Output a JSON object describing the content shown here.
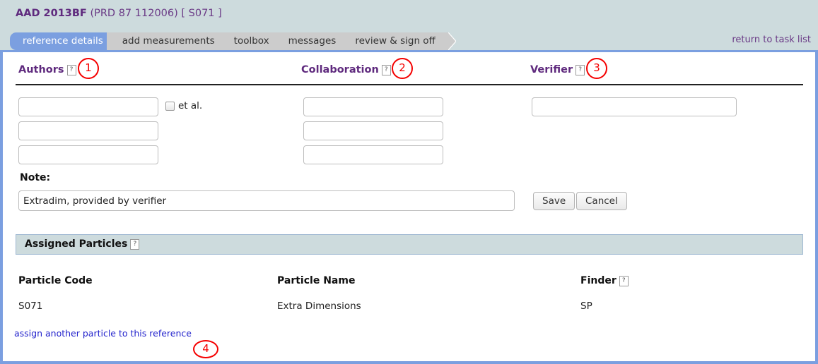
{
  "header": {
    "title_main": "AAD 2013BF",
    "title_sub": "(PRD 87 112006)  [ S071 ]",
    "return_link": "return to task list"
  },
  "tabs": [
    {
      "label": "reference details",
      "active": true
    },
    {
      "label": "add measurements",
      "active": false
    },
    {
      "label": "toolbox",
      "active": false
    },
    {
      "label": "messages",
      "active": false
    },
    {
      "label": "review & sign off",
      "active": false
    }
  ],
  "columns": {
    "authors": {
      "label": "Authors",
      "help": "?"
    },
    "collaboration": {
      "label": "Collaboration",
      "help": "?"
    },
    "verifier": {
      "label": "Verifier",
      "help": "?"
    }
  },
  "fields": {
    "author_1": {
      "value": "",
      "placeholder": ""
    },
    "author_2": {
      "value": "",
      "placeholder": ""
    },
    "author_3": {
      "value": "",
      "placeholder": ""
    },
    "collaboration_1": {
      "value": "",
      "placeholder": ""
    },
    "collaboration_2": {
      "value": "",
      "placeholder": ""
    },
    "collaboration_3": {
      "value": "",
      "placeholder": ""
    },
    "verifier_1": {
      "value": "",
      "placeholder": ""
    },
    "et_al": {
      "label": "et al.",
      "checked": false
    },
    "note": {
      "label": "Note:",
      "value": "Extradim, provided by verifier",
      "placeholder": ""
    }
  },
  "buttons": {
    "save": "Save",
    "cancel": "Cancel"
  },
  "assigned_particles": {
    "section_title": "Assigned Particles",
    "section_help": "?",
    "headers": [
      "Particle Code",
      "Particle Name",
      "Finder"
    ],
    "finder_help": "?",
    "rows": [
      {
        "particle_code": "S071",
        "particle_name": "Extra Dimensions",
        "finder": "SP"
      }
    ],
    "assign_link": "assign another particle to this reference"
  },
  "annotations": [
    {
      "number": "1"
    },
    {
      "number": "2"
    },
    {
      "number": "3"
    },
    {
      "number": "4"
    }
  ],
  "colors": {
    "header_bg": "#cddbdd",
    "panel_border": "#7b9fe0",
    "active_tab": "#7b9fe0",
    "inactive_tab": "#cccccc",
    "heading_purple": "#5f2a7e",
    "link_blue": "#2222cc",
    "annotation_red": "#f50000"
  }
}
